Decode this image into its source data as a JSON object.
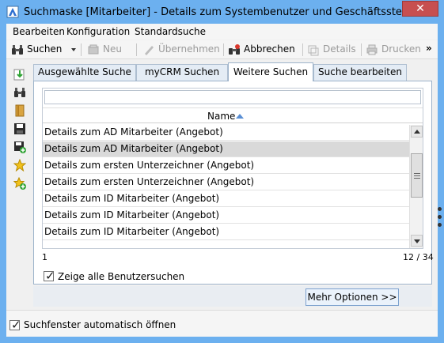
{
  "window": {
    "title": "Suchmaske [Mitarbeiter] - Details zum Systembenutzer und Geschäftsstelle",
    "close_glyph": "✕"
  },
  "menubar": {
    "items": [
      "Bearbeiten",
      "Konfiguration",
      "Standardsuche"
    ]
  },
  "toolbar": {
    "search_label": "Suchen",
    "new_label": "Neu",
    "apply_label": "Übernehmen",
    "cancel_label": "Abbrechen",
    "details_label": "Details",
    "print_label": "Drucken",
    "more_glyph": "»"
  },
  "tabs": [
    {
      "label": "Ausgewählte Suche",
      "active": false
    },
    {
      "label": "myCRM Suchen",
      "active": false
    },
    {
      "label": "Weitere Suchen",
      "active": true
    },
    {
      "label": "Suche bearbeiten",
      "active": false
    }
  ],
  "filter": {
    "value": "",
    "placeholder": ""
  },
  "grid": {
    "column_header": "Name",
    "sort": "ascending",
    "rows": [
      {
        "label": "Details zum AD Mitarbeiter (Angebot)",
        "selected": false
      },
      {
        "label": "Details zum AD Mitarbeiter (Angebot)",
        "selected": true
      },
      {
        "label": "Details zum ersten Unterzeichner (Angebot)",
        "selected": false
      },
      {
        "label": "Details zum ersten Unterzeichner (Angebot)",
        "selected": false
      },
      {
        "label": "Details zum ID Mitarbeiter (Angebot)",
        "selected": false
      },
      {
        "label": "Details zum ID Mitarbeiter (Angebot)",
        "selected": false
      },
      {
        "label": "Details zum ID Mitarbeiter (Angebot)",
        "selected": false
      }
    ],
    "status_left": "1",
    "status_right": "12 / 34"
  },
  "show_all_user_searches": {
    "label": "Zeige alle Benutzersuchen",
    "checked": true
  },
  "more_options_label": "Mehr Optionen >>",
  "auto_open": {
    "label": "Suchfenster automatisch öffnen",
    "checked": true
  },
  "colors": {
    "titlebar": "#6cb0ef",
    "close": "#c74f50",
    "accent": "#5a8fd4"
  }
}
